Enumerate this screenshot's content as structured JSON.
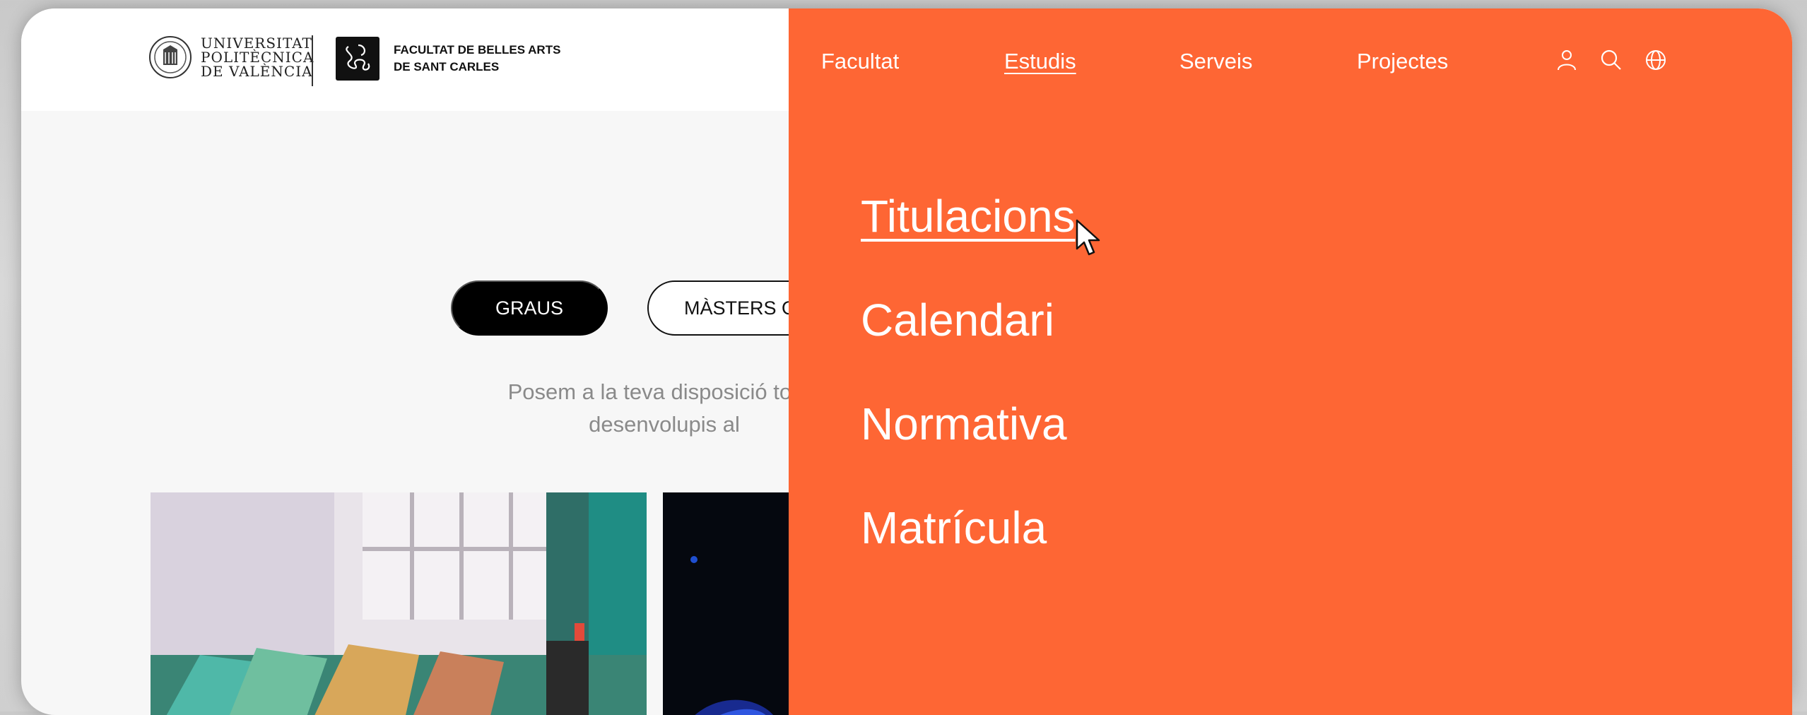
{
  "header": {
    "upv_logo_lines": [
      "UNIVERSITAT",
      "POLITÈCNICA",
      "DE VALÈNCIA"
    ],
    "faculty_logo_lines": [
      "FACULTAT DE BELLES ARTS",
      "DE SANT CARLES"
    ]
  },
  "nav": {
    "items": [
      {
        "label": "Facultat"
      },
      {
        "label": "Estudis",
        "active": true
      },
      {
        "label": "Serveis"
      },
      {
        "label": "Projectes"
      }
    ],
    "icons": [
      "user-icon",
      "search-icon",
      "globe-icon"
    ]
  },
  "submenu": {
    "items": [
      {
        "label": "Titulacions",
        "hovered": true
      },
      {
        "label": "Calendari"
      },
      {
        "label": "Normativa"
      },
      {
        "label": "Matrícula"
      }
    ]
  },
  "content": {
    "filters": [
      {
        "label": "GRAUS",
        "active": true
      },
      {
        "label": "MÀSTERS O"
      }
    ],
    "intro_lines": [
      "Posem a la teva disposició totes",
      "desenvolupis al"
    ]
  },
  "colors": {
    "menu_bg": "#fe6634",
    "page_bg": "#f7f7f7",
    "header_bg": "#ffffff",
    "active_pill": "#000000"
  }
}
